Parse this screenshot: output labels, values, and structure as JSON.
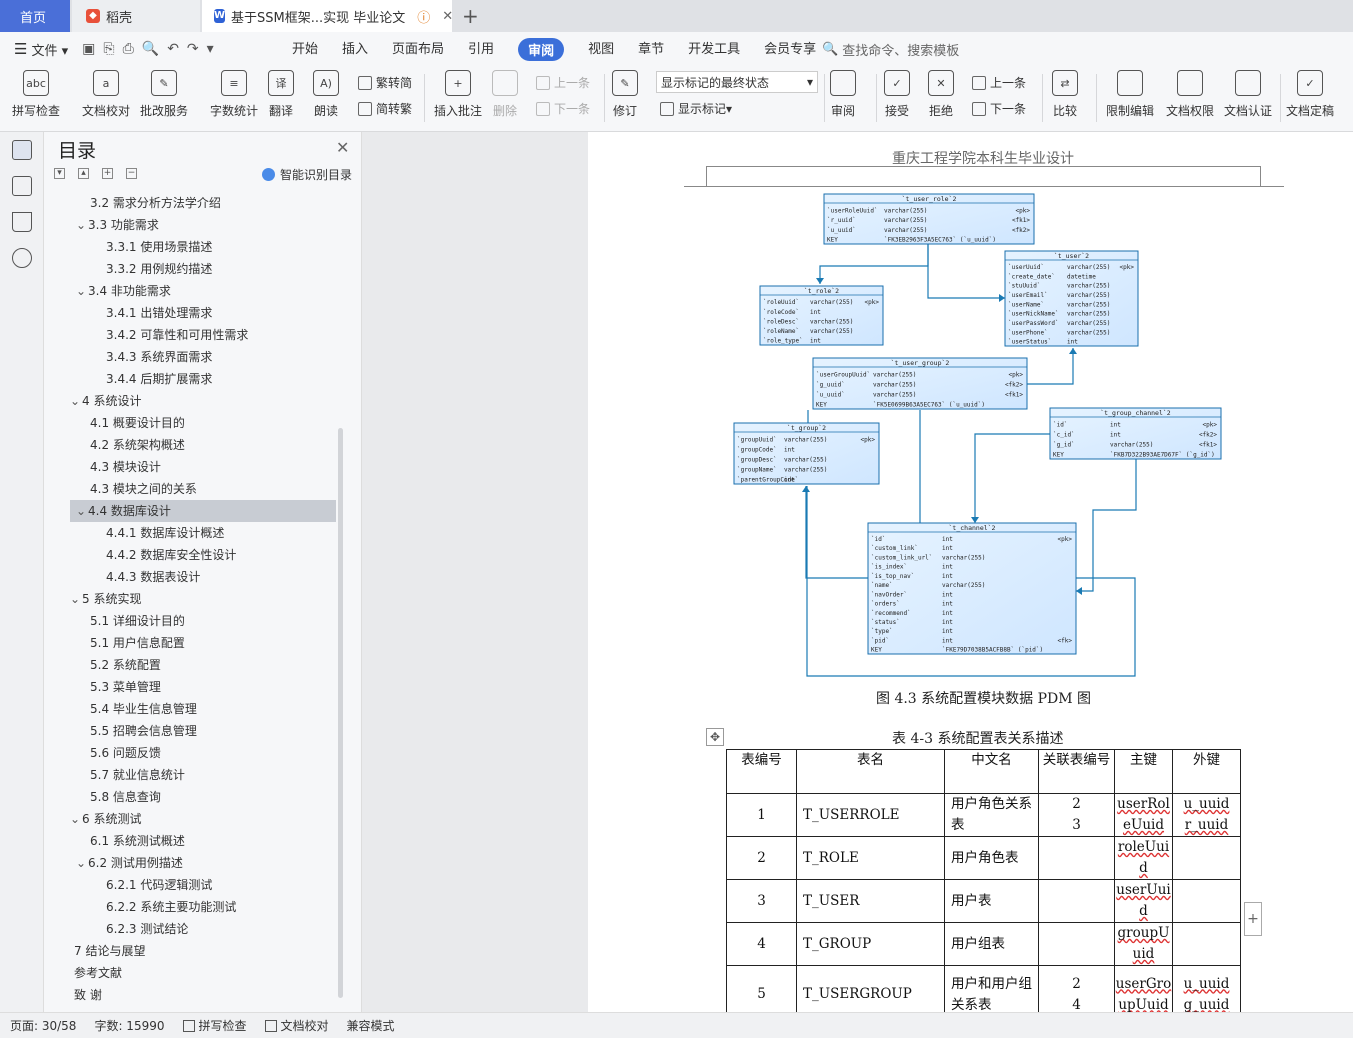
{
  "tabs": {
    "home": "首页",
    "daoke": "稻壳",
    "doc": "基于SSM框架...实现 毕业论文"
  },
  "menu": {
    "file": "文件",
    "items": [
      "开始",
      "插入",
      "页面布局",
      "引用",
      "审阅",
      "视图",
      "章节",
      "开发工具",
      "会员专享"
    ],
    "active": "审阅",
    "search": "查找命令、搜索模板"
  },
  "ribbon": {
    "spell": "拼写检查",
    "proof": "文档校对",
    "batch": "批改服务",
    "wordcount": "字数统计",
    "translate": "翻译",
    "read": "朗读",
    "t2s": "繁转简",
    "s2t": "简转繁",
    "add_comment": "插入批注",
    "delete": "删除",
    "prev_c": "上一条",
    "next_c": "下一条",
    "revise": "修订",
    "markup_select": "显示标记的最终状态",
    "show_markup": "显示标记",
    "review": "审阅",
    "accept": "接受",
    "reject": "拒绝",
    "prev": "上一条",
    "next": "下一条",
    "compare": "比较",
    "restrict": "限制编辑",
    "perm": "文档权限",
    "auth": "文档认证",
    "final": "文档定稿"
  },
  "toc": {
    "title": "目录",
    "smart": "智能识别目录",
    "items": [
      {
        "t": "3.2  需求分析方法学介绍",
        "lvl": 2,
        "c": ""
      },
      {
        "t": "3.3 功能需求",
        "lvl": 2,
        "c": "v"
      },
      {
        "t": "3.3.1 使用场景描述",
        "lvl": 3,
        "c": ""
      },
      {
        "t": "3.3.2 用例规约描述",
        "lvl": 3,
        "c": ""
      },
      {
        "t": "3.4  非功能需求",
        "lvl": 2,
        "c": "v"
      },
      {
        "t": "3.4.1  出错处理需求",
        "lvl": 3,
        "c": ""
      },
      {
        "t": "3.4.2  可靠性和可用性需求",
        "lvl": 3,
        "c": ""
      },
      {
        "t": "3.4.3  系统界面需求",
        "lvl": 3,
        "c": ""
      },
      {
        "t": "3.4.4  后期扩展需求",
        "lvl": 3,
        "c": ""
      },
      {
        "t": "4  系统设计",
        "lvl": 1,
        "c": "v"
      },
      {
        "t": "4.1  概要设计目的",
        "lvl": 2,
        "c": ""
      },
      {
        "t": "4.2  系统架构概述",
        "lvl": 2,
        "c": ""
      },
      {
        "t": "4.3  模块设计",
        "lvl": 2,
        "c": ""
      },
      {
        "t": "4.3  模块之间的关系",
        "lvl": 2,
        "c": ""
      },
      {
        "t": "4.4  数据库设计",
        "lvl": 2,
        "c": "v",
        "sel": true
      },
      {
        "t": "4.4.1  数据库设计概述",
        "lvl": 3,
        "c": ""
      },
      {
        "t": "4.4.2  数据库安全性设计",
        "lvl": 3,
        "c": ""
      },
      {
        "t": "4.4.3 数据表设计",
        "lvl": 3,
        "c": ""
      },
      {
        "t": "5  系统实现",
        "lvl": 1,
        "c": "v"
      },
      {
        "t": "5.1  详细设计目的",
        "lvl": 2,
        "c": ""
      },
      {
        "t": "5.1  用户信息配置",
        "lvl": 2,
        "c": ""
      },
      {
        "t": "5.2  系统配置",
        "lvl": 2,
        "c": ""
      },
      {
        "t": "5.3  菜单管理",
        "lvl": 2,
        "c": ""
      },
      {
        "t": "5.4  毕业生信息管理",
        "lvl": 2,
        "c": ""
      },
      {
        "t": "5.5  招聘会信息管理",
        "lvl": 2,
        "c": ""
      },
      {
        "t": "5.6  问题反馈",
        "lvl": 2,
        "c": ""
      },
      {
        "t": "5.7  就业信息统计",
        "lvl": 2,
        "c": ""
      },
      {
        "t": "5.8  信息查询",
        "lvl": 2,
        "c": ""
      },
      {
        "t": "6  系统测试",
        "lvl": 1,
        "c": "v"
      },
      {
        "t": "6.1  系统测试概述",
        "lvl": 2,
        "c": ""
      },
      {
        "t": "6.2  测试用例描述",
        "lvl": 2,
        "c": "v"
      },
      {
        "t": "6.2.1  代码逻辑测试",
        "lvl": 3,
        "c": ""
      },
      {
        "t": "6.2.2  系统主要功能测试",
        "lvl": 3,
        "c": ""
      },
      {
        "t": "6.2.3  测试结论",
        "lvl": 3,
        "c": ""
      },
      {
        "t": "7  结论与展望",
        "lvl": 1,
        "c": ""
      },
      {
        "t": "参考文献",
        "lvl": 1,
        "c": ""
      },
      {
        "t": "致    谢",
        "lvl": 1,
        "c": ""
      }
    ]
  },
  "doc": {
    "header": "重庆工程学院本科生毕业设计",
    "figure_caption": "图  4.3  系统配置模块数据 PDM 图",
    "table_caption": "表  4-3  系统配置表关系描述",
    "table_headers": [
      "表编号",
      "表名",
      "中文名",
      "关联表编号",
      "主键",
      "外键"
    ],
    "table_rows": [
      [
        "1",
        "T_USERROLE",
        "用户角色关系表",
        "2\n3",
        "userRoleUuid",
        "u_uuid\nr_uuid"
      ],
      [
        "2",
        "T_ROLE",
        "用户角色表",
        "",
        "roleUuid",
        ""
      ],
      [
        "3",
        "T_USER",
        "用户表",
        "",
        "userUuid",
        ""
      ],
      [
        "4",
        "T_GROUP",
        "用户组表",
        "",
        "groupUuid",
        ""
      ],
      [
        "5",
        "T_USERGROUP",
        "用户和用户组关系表",
        "2\n4",
        "userGroupUuid",
        "u_uuid\ng_uuid"
      ]
    ],
    "diagram": {
      "t_user_role": {
        "title": "`t_user_role`2",
        "rows": [
          [
            "`userRoleUuid`",
            "varchar(255)",
            "<pk>"
          ],
          [
            "`r_uuid`",
            "varchar(255)",
            "<fk1>"
          ],
          [
            "`u_uuid`",
            "varchar(255)",
            "<fk2>"
          ],
          [
            "KEY",
            "`FK3EB2963F3A5EC763` (`u_uuid`)",
            ""
          ]
        ]
      },
      "t_user": {
        "title": "`t_user`2",
        "rows": [
          [
            "`userUuid`",
            "varchar(255)",
            "<pk>"
          ],
          [
            "`create_date`",
            "datetime",
            ""
          ],
          [
            "`stuUuid`",
            "varchar(255)",
            ""
          ],
          [
            "`userEmail`",
            "varchar(255)",
            ""
          ],
          [
            "`userName`",
            "varchar(255)",
            ""
          ],
          [
            "`userNickName`",
            "varchar(255)",
            ""
          ],
          [
            "`userPassWord`",
            "varchar(255)",
            ""
          ],
          [
            "`userPhone`",
            "varchar(255)",
            ""
          ],
          [
            "`userStatus`",
            "int",
            ""
          ]
        ]
      },
      "t_role": {
        "title": "`t_role`2",
        "rows": [
          [
            "`roleUuid`",
            "varchar(255)",
            "<pk>"
          ],
          [
            "`roleCode`",
            "int",
            ""
          ],
          [
            "`roleDesc`",
            "varchar(255)",
            ""
          ],
          [
            "`roleName`",
            "varchar(255)",
            ""
          ],
          [
            "`role_type`",
            "int",
            ""
          ]
        ]
      },
      "t_user_group": {
        "title": "`t_user_group`2",
        "rows": [
          [
            "`userGroupUuid`",
            "varchar(255)",
            "<pk>"
          ],
          [
            "`g_uuid`",
            "varchar(255)",
            "<fk2>"
          ],
          [
            "`u_uuid`",
            "varchar(255)",
            "<fk1>"
          ],
          [
            "KEY",
            "`FK5E0699B63A5EC763` (`u_uuid`)",
            ""
          ]
        ]
      },
      "t_group_channel": {
        "title": "`t_group_channel`2",
        "rows": [
          [
            "`id`",
            "int",
            "<pk>"
          ],
          [
            "`c_id`",
            "int",
            "<fk2>"
          ],
          [
            "`g_id`",
            "varchar(255)",
            "<fk1>"
          ],
          [
            "KEY",
            "`FKB7D322B93AE7D67F` (`g_id`)",
            ""
          ]
        ]
      },
      "t_group": {
        "title": "`t_group`2",
        "rows": [
          [
            "`groupUuid`",
            "varchar(255)",
            "<pk>"
          ],
          [
            "`groupCode`",
            "int",
            ""
          ],
          [
            "`groupDesc`",
            "varchar(255)",
            ""
          ],
          [
            "`groupName`",
            "varchar(255)",
            ""
          ],
          [
            "`parentGroupCode`",
            "int",
            ""
          ]
        ]
      },
      "t_channel": {
        "title": "`t_channel`2",
        "rows": [
          [
            "`id`",
            "int",
            "<pk>"
          ],
          [
            "`custom_link`",
            "int",
            ""
          ],
          [
            "`custom_link_url`",
            "varchar(255)",
            ""
          ],
          [
            "`is_index`",
            "int",
            ""
          ],
          [
            "`is_top_nav`",
            "int",
            ""
          ],
          [
            "`name`",
            "varchar(255)",
            ""
          ],
          [
            "`navOrder`",
            "int",
            ""
          ],
          [
            "`orders`",
            "int",
            ""
          ],
          [
            "`recommend`",
            "int",
            ""
          ],
          [
            "`status`",
            "int",
            ""
          ],
          [
            "`type`",
            "int",
            ""
          ],
          [
            "`pid`",
            "int",
            "<fk>"
          ],
          [
            "KEY",
            "`FKE79D7038B5ACFB8B` (`pid`)",
            ""
          ]
        ]
      }
    }
  },
  "status": {
    "page": "页面: 30/58",
    "words": "字数: 15990",
    "spell": "拼写检查",
    "proof": "文档校对",
    "compat": "兼容模式"
  },
  "colors": {
    "accent": "#3b6fd9",
    "entity_fill": "#cfe6ff",
    "entity_border": "#1a6fae",
    "link": "#1a7ab3"
  }
}
